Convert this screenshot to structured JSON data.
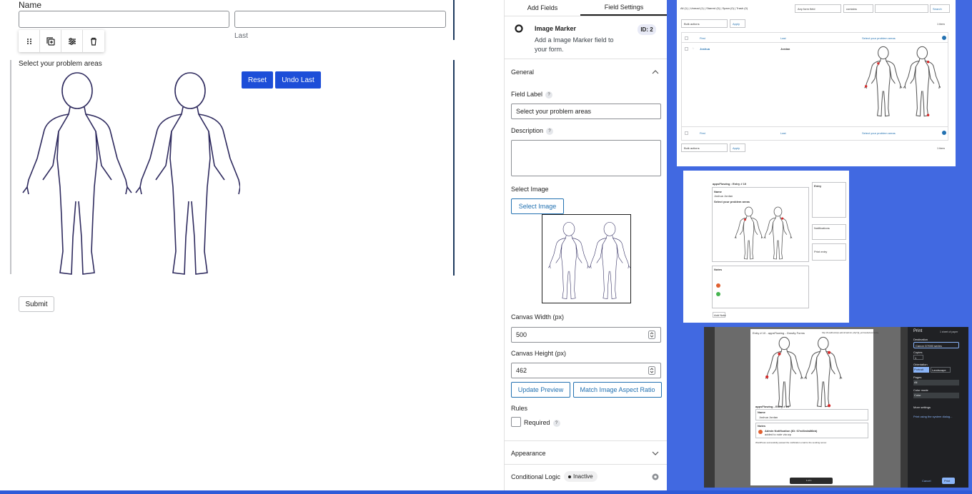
{
  "form": {
    "name_label": "Name",
    "last_sublabel": "Last",
    "problem_label": "Select your problem areas",
    "reset_label": "Reset",
    "undo_label": "Undo Last",
    "submit_label": "Submit"
  },
  "settings": {
    "tabs": [
      "Add Fields",
      "Field Settings"
    ],
    "field_title": "Image Marker",
    "field_desc": "Add a Image Marker field to your form.",
    "field_id": "ID: 2",
    "general_label": "General",
    "field_label_label": "Field Label",
    "field_label_value": "Select your problem areas",
    "description_label": "Description",
    "select_image_label": "Select Image",
    "select_image_button": "Select Image",
    "canvas_width_label": "Canvas Width (px)",
    "canvas_width_value": "500",
    "canvas_height_label": "Canvas Height (px)",
    "canvas_height_value": "462",
    "update_preview_button": "Update Preview",
    "match_ratio_button": "Match Image Aspect Ratio",
    "rules_label": "Rules",
    "required_label": "Required",
    "appearance_label": "Appearance",
    "conditional_label": "Conditional Logic",
    "conditional_status": "Inactive",
    "help": "?"
  },
  "entries": {
    "filters": "All (1) | Unread (1) | Starred (0) | Spam (0) | Trash (0)",
    "field_select": "Any form field",
    "operator_select": "contains",
    "search_button": "Search",
    "bulk_actions": "Bulk actions",
    "apply_button": "Apply",
    "item_count": "1 item",
    "columns": [
      "First",
      "Last",
      "Select your problem areas"
    ],
    "row": {
      "first": "Joshua",
      "last": "Jordan"
    }
  },
  "entry_detail": {
    "title": "appsFlowing : Entry # 10",
    "name_label": "Name",
    "name_value": "Joshua Jordan",
    "field_label": "Select your problem areas",
    "notes_label": "Notes",
    "entry_label": "Entry",
    "notification_label": "Notifications",
    "print_label": "Print entry",
    "add_note_button": "Add Note"
  },
  "print_dialog": {
    "header_left": "Entry # 10 - appsFlowing - Gravity Forms",
    "header_right": "http://localhost/wp-admin/admin.php?gf_entries&view=entry",
    "title": "Print",
    "sheets": "1 sheet of paper",
    "destination_label": "Destination",
    "destination_value": "Canon G7000 series",
    "copies_label": "Copies",
    "copies_value": "1",
    "orientation_label": "Orientation",
    "portrait": "Portrait",
    "landscape": "Landscape",
    "pages_label": "Pages",
    "pages_value": "All",
    "color_label": "Color mode",
    "color_value": "Color",
    "more_settings": "More settings",
    "system_dialog": "Print using the system dialog...",
    "cancel_button": "Cancel",
    "print_button": "Print",
    "entry_title": "appsFlowing - Entry # 10",
    "name_label": "Name",
    "name_value": "Joshua Jordan",
    "notes_label": "Notes",
    "note_author": "Admin Notification (ID: 67ed3eda86bb)",
    "note_sub": "added to note via wp",
    "note_body": "WordPress successfully passed the notification email to the sending server.",
    "page_indicator": "1 of 1"
  }
}
